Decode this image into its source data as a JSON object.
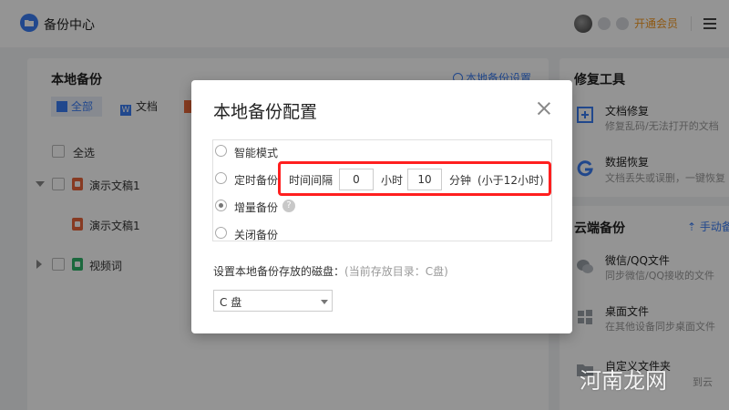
{
  "app": {
    "title": "备份中心",
    "vip_label": "开通会员"
  },
  "local_backup": {
    "title": "本地备份",
    "settings_link": "本地备份设置",
    "tabs": [
      {
        "label": "全部"
      },
      {
        "label": "文档",
        "icon_text": "W"
      }
    ],
    "select_all": "全选",
    "tree": [
      {
        "label": "演示文稿1",
        "icon": "ppt-file-icon"
      },
      {
        "label": "演示文稿1",
        "icon": "ppt-file-icon"
      },
      {
        "label": "视频词",
        "icon": "video-file-icon"
      }
    ]
  },
  "repair_tools": {
    "title": "修复工具",
    "items": [
      {
        "title": "文档修复",
        "sub": "修复乱码/无法打开的文档"
      },
      {
        "title": "数据恢复",
        "sub": "文档丢失或误删，一键恢复"
      }
    ]
  },
  "cloud_backup": {
    "title": "云端备份",
    "upload_link": "手动备",
    "items": [
      {
        "title": "微信/QQ文件",
        "sub": "同步微信/QQ接收的文件"
      },
      {
        "title": "桌面文件",
        "sub": "在其他设备同步桌面文件"
      },
      {
        "title": "自定义文件夹",
        "sub": "到云"
      }
    ]
  },
  "dialog": {
    "title": "本地备份配置",
    "options": [
      {
        "label": "智能模式",
        "checked": false
      },
      {
        "label": "定时备份",
        "checked": false
      },
      {
        "label": "增量备份",
        "checked": true
      },
      {
        "label": "关闭备份",
        "checked": false
      }
    ],
    "interval_label": "时间间隔",
    "hours_value": "0",
    "hours_unit": "小时",
    "minutes_value": "10",
    "minutes_unit": "分钟",
    "interval_note": "(小于12小时)",
    "help_glyph": "?",
    "disk_label": "设置本地备份存放的磁盘：",
    "disk_hint": "(当前存放目录：C盘)",
    "disk_selected": "C 盘"
  },
  "watermark": {
    "text": "河南龙网"
  },
  "colors": {
    "accent": "#3a7cf3",
    "highlight_box": "#ff1f1f",
    "vip": "#f59a23"
  }
}
